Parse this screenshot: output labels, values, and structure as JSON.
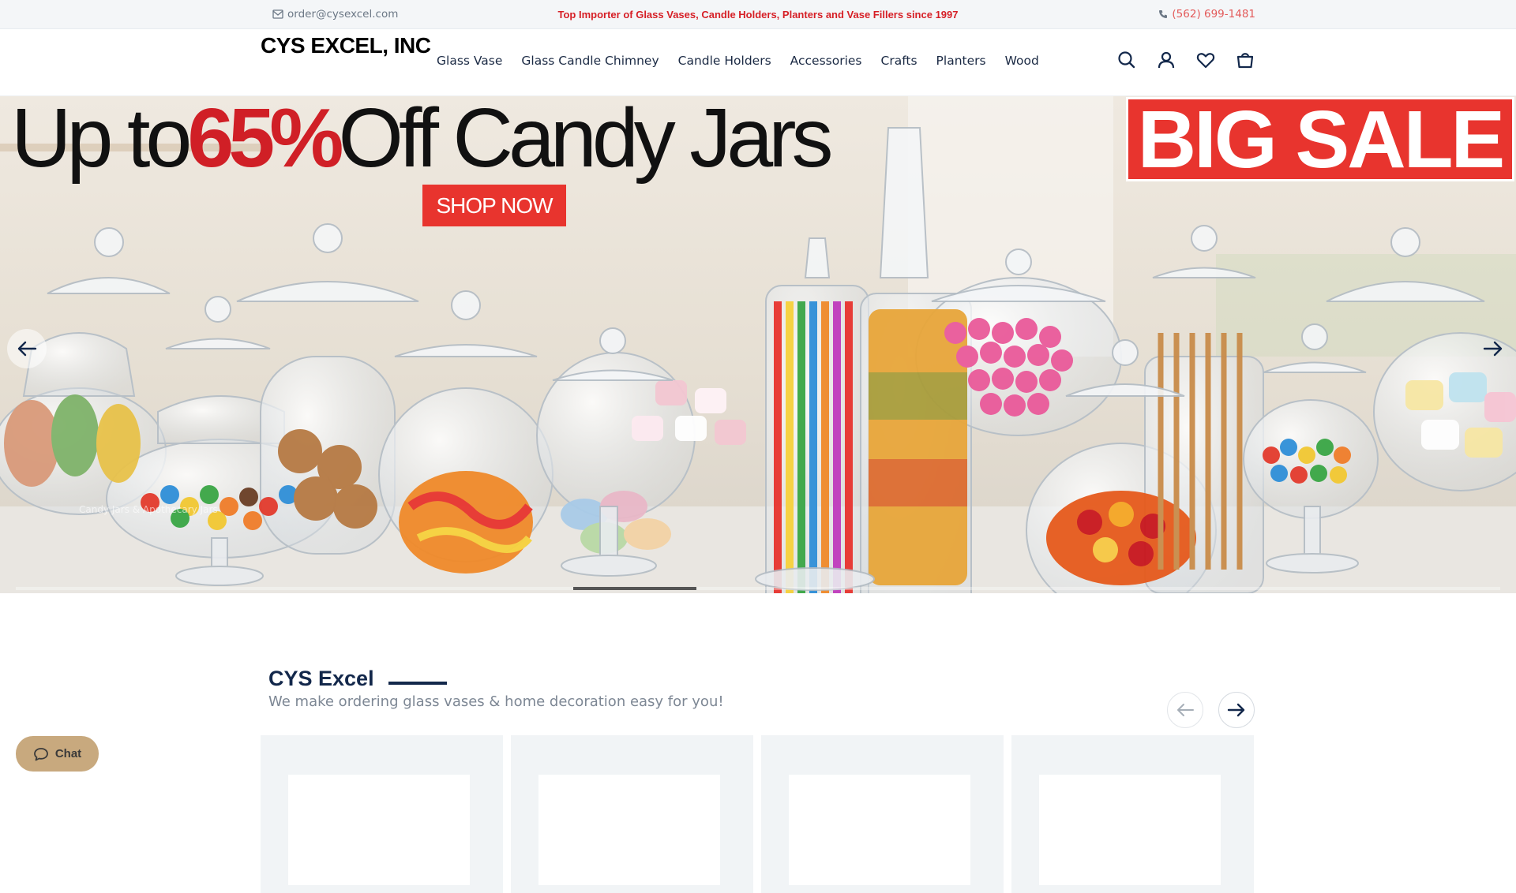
{
  "topbar": {
    "email": "order@cysexcel.com",
    "tagline": "Top Importer of Glass Vases, Candle Holders, Planters and Vase Fillers since 1997",
    "phone": "(562) 699-1481",
    "tagline_color": "#d61f26",
    "phone_color": "#e35a5a"
  },
  "header": {
    "logo": "CYS EXCEL, INC",
    "nav": [
      "Glass Vase",
      "Glass Candle Chimney",
      "Candle Holders",
      "Accessories",
      "Crafts",
      "Planters",
      "Wood"
    ],
    "icons": [
      "search-icon",
      "account-icon",
      "wishlist-heart-icon",
      "shopping-bag-icon"
    ]
  },
  "hero": {
    "headline_pre": "Up to",
    "headline_pct": "65%",
    "headline_post": "Off Candy Jars",
    "cta": "SHOP NOW",
    "badge": "BIG SALE",
    "caption": "Candy Jars & Apothecary Jars",
    "accent_color": "#e8342e",
    "slide_progress": 0.417
  },
  "section": {
    "title": "CYS Excel",
    "subtitle": "We make ordering glass vases & home decoration easy for you!",
    "title_color": "#13284b"
  },
  "chat": {
    "label": "Chat"
  }
}
